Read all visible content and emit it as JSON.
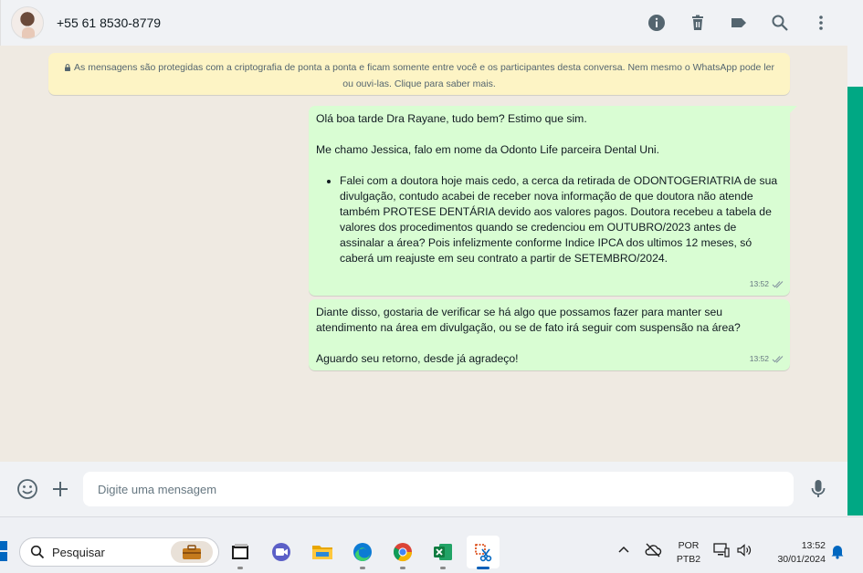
{
  "header": {
    "contact_name": "+55 61 8530-8779",
    "icons": [
      "info-icon",
      "trash-icon",
      "label-icon",
      "search-icon",
      "kebab-menu-icon"
    ]
  },
  "encryption_notice": "As mensagens são protegidas com a criptografia de ponta a ponta e ficam somente entre você e os participantes desta conversa. Nem mesmo o WhatsApp pode ler ou ouvi-las. Clique para saber mais.",
  "messages": [
    {
      "greeting": "Olá boa tarde Dra Rayane, tudo bem? Estimo que sim.",
      "intro": "Me chamo Jessica, falo em nome da Odonto Life parceira Dental Uni.",
      "bullet": "Falei com a doutora hoje mais cedo, a cerca da retirada de ODONTOGERIATRIA de sua divulgação, contudo acabei de receber nova informação de que doutora não atende também PROTESE DENTÁRIA devido aos valores pagos. Doutora recebeu a tabela de valores dos procedimentos quando se credenciou em OUTUBRO/2023 antes de assinalar a área? Pois infelizmente conforme Indice IPCA dos ultimos 12 meses, só caberá um reajuste em seu contrato a partir de SETEMBRO/2024.",
      "time": "13:52"
    },
    {
      "body": "Diante disso, gostaria de verificar se há algo que possamos fazer para manter seu atendimento na área em divulgação, ou se de fato irá seguir com suspensão na área?",
      "closing": "Aguardo seu retorno, desde já agradeço!",
      "time": "13:52"
    }
  ],
  "composer": {
    "placeholder": "Digite uma mensagem"
  },
  "taskbar": {
    "search_label": "Pesquisar",
    "apps": [
      "briefcase-app",
      "terminal-app",
      "meet-app",
      "file-explorer-app",
      "edge-app",
      "chrome-app",
      "excel-app",
      "snipping-tool-app"
    ],
    "lang_line1": "POR",
    "lang_line2": "PTB2",
    "time": "13:52",
    "date": "30/01/2024"
  },
  "colors": {
    "outgoing_bubble": "#d9fdd3",
    "chat_bg": "#efeae2",
    "banner_bg": "#fdf4c5",
    "accent": "#00a884"
  }
}
